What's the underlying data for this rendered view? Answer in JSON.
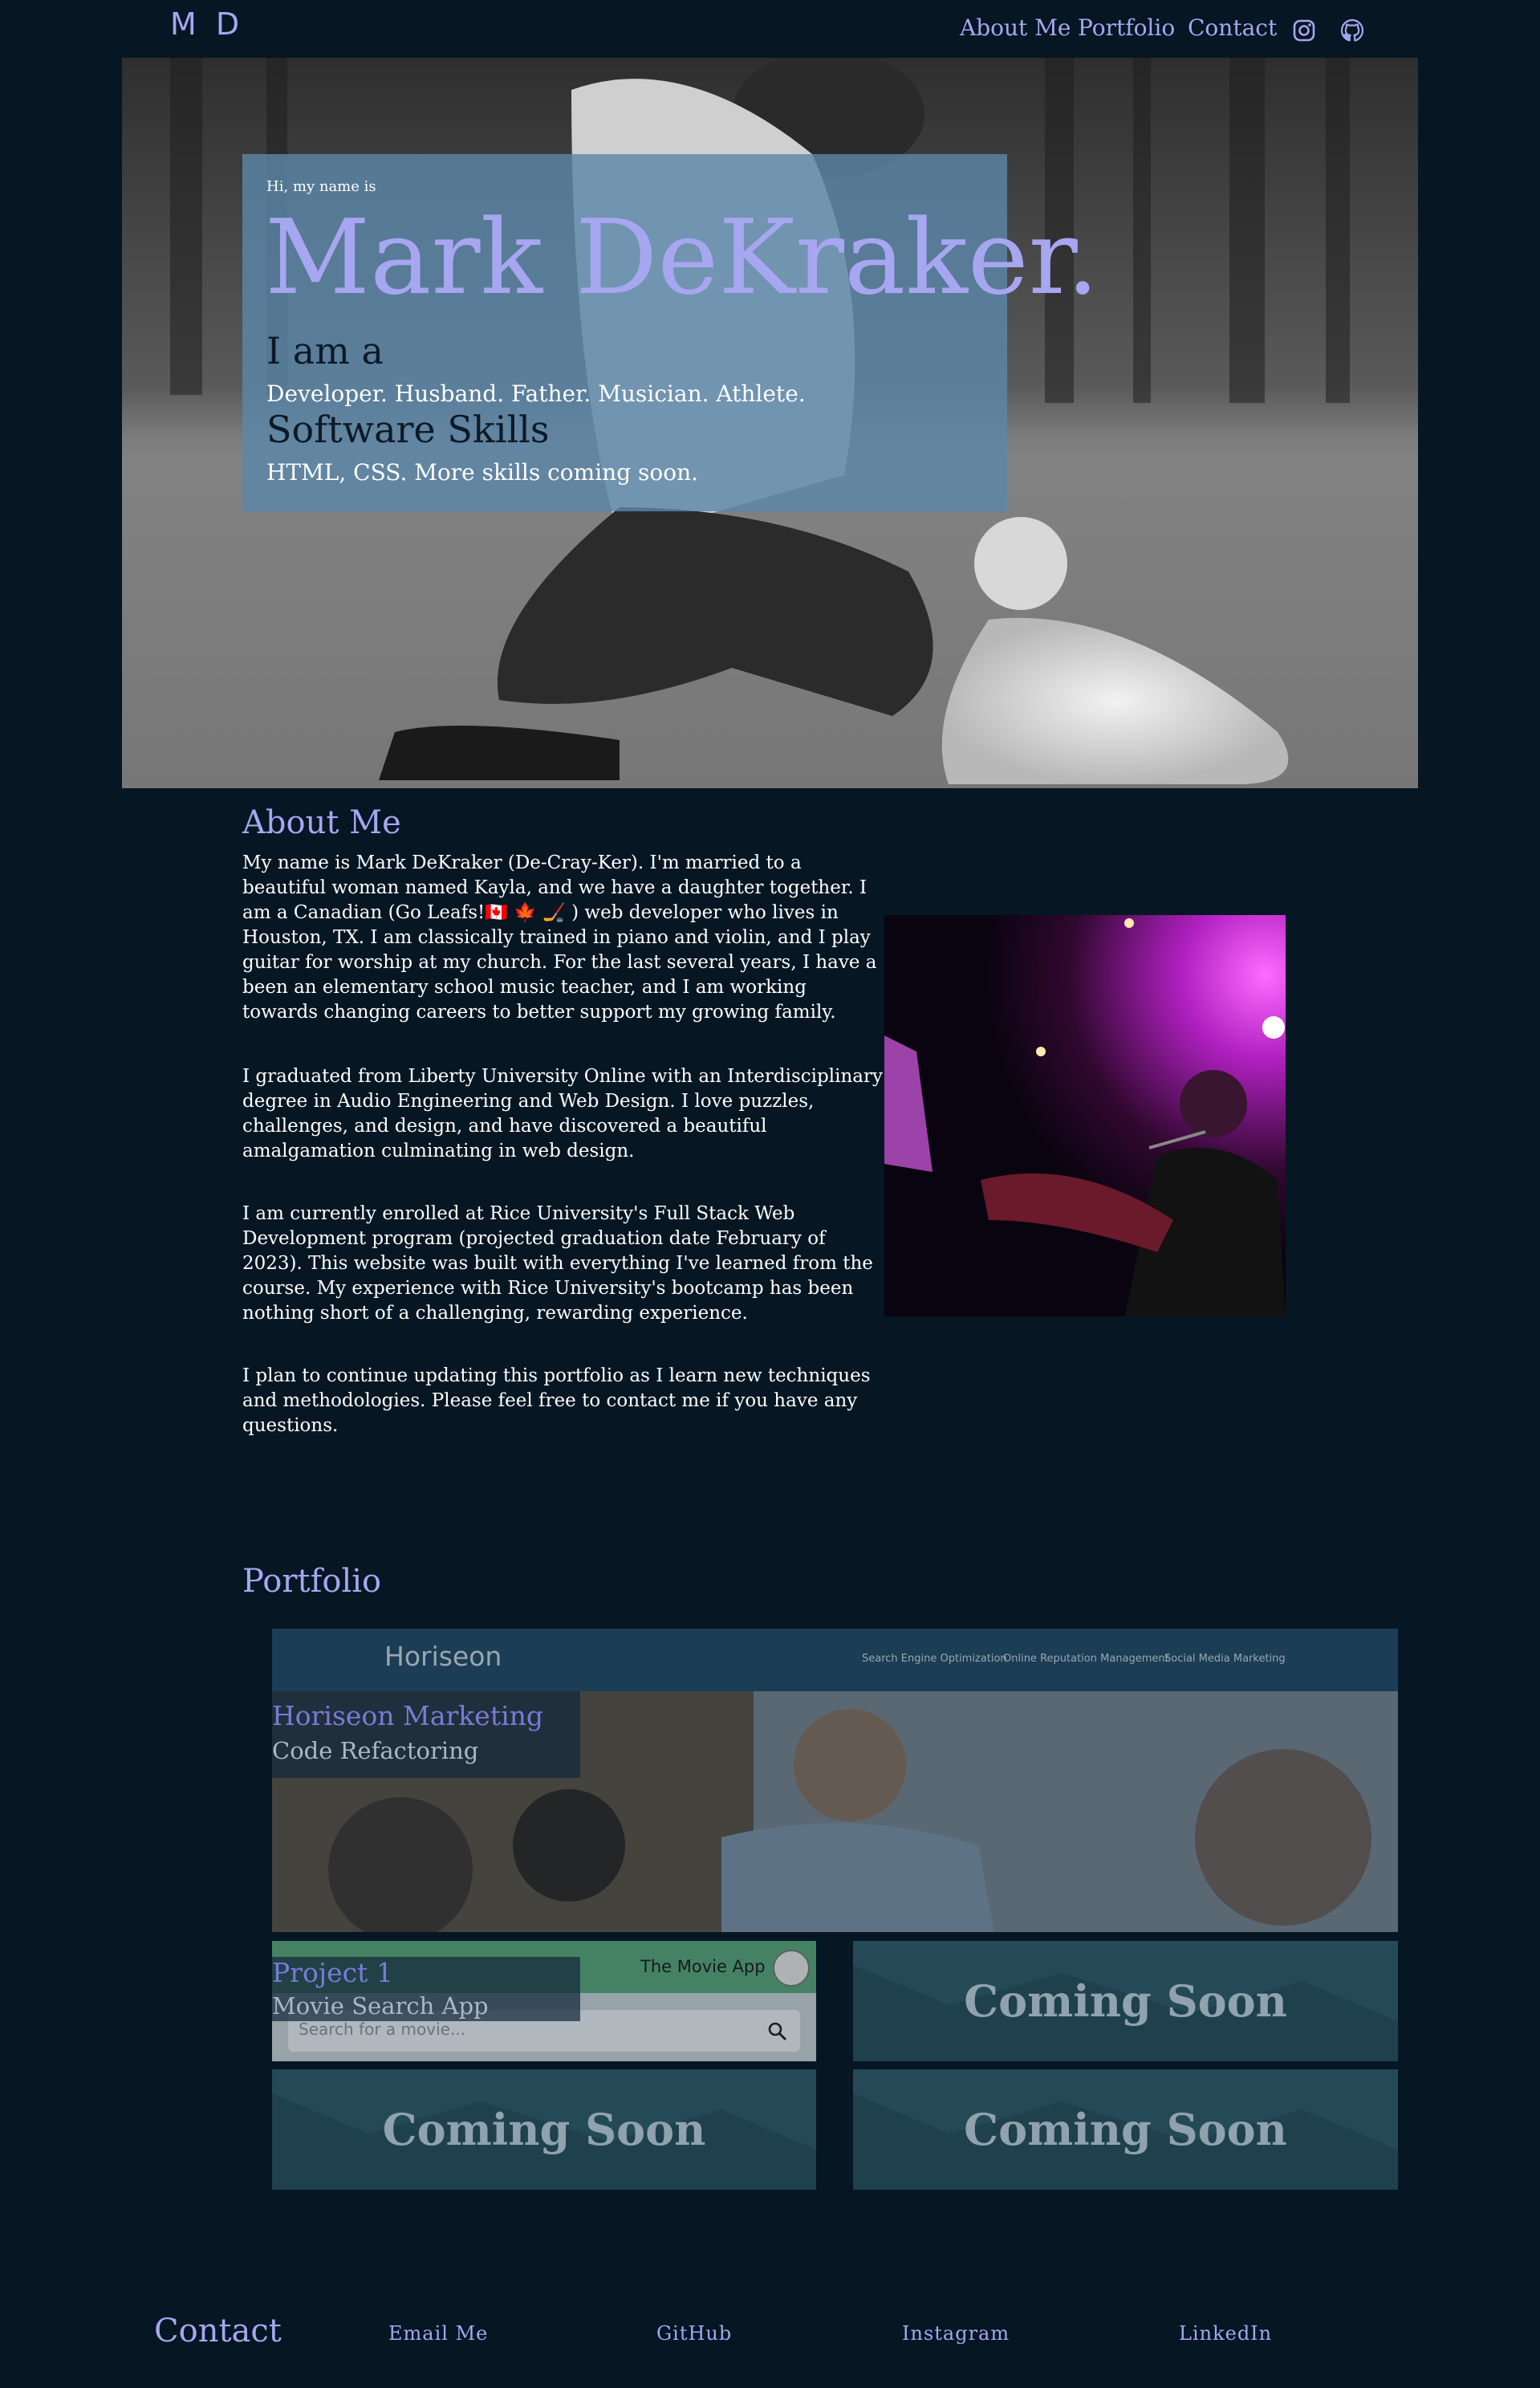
{
  "header": {
    "logo": "M D",
    "nav": [
      "About Me",
      "Portfolio",
      "Contact"
    ],
    "icons": [
      "instagram-icon",
      "github-icon"
    ]
  },
  "hero": {
    "greeting": "Hi, my name is",
    "name": "Mark DeKraker.",
    "iam_heading": "I am a",
    "iam_text": "Developer. Husband. Father. Musician. Athlete.",
    "skills_heading": "Software Skills",
    "skills_text": "HTML, CSS. More skills coming soon."
  },
  "about": {
    "title": "About Me",
    "paragraphs": [
      "My name is Mark DeKraker (De-Cray-Ker). I'm married to a beautiful woman named Kayla, and we have a daughter together. I am a Canadian (Go Leafs!🇨🇦 🍁 🏒 ) web developer who lives in Houston, TX. I am classically trained in piano and violin, and I play guitar for worship at my church. For the last several years, I have a been an elementary school music teacher, and I am working towards changing careers to better support my growing family.",
      "I graduated from Liberty University Online with an Interdisciplinary degree in Audio Engineering and Web Design. I love puzzles, challenges, and design, and have discovered a beautiful amalgamation culminating in web design.",
      "I am currently enrolled at Rice University's Full Stack Web Development program (projected graduation date February of 2023). This website was built with everything I've learned from the course. My experience with Rice University's bootcamp has been nothing short of a challenging, rewarding experience.",
      "I plan to continue updating this portfolio as I learn new techniques and methodologies. Please feel free to contact me if you have any questions."
    ]
  },
  "portfolio": {
    "title": "Portfolio",
    "featured": {
      "title": "Horiseon Marketing",
      "subtitle": "Code Refactoring",
      "screenshot_brand": "Horiseon",
      "screenshot_nav": [
        "Search Engine Optimization",
        "Online Reputation Management",
        "Social Media Marketing"
      ]
    },
    "project1": {
      "title": "Project 1",
      "subtitle": "Movie Search App",
      "screenshot_title": "The Movie App",
      "screenshot_placeholder": "Search for a movie..."
    },
    "coming_soon": [
      "Coming Soon",
      "Coming Soon",
      "Coming Soon"
    ]
  },
  "contact": {
    "title": "Contact",
    "links": [
      "Email Me",
      "GitHub",
      "Instagram",
      "LinkedIn"
    ]
  },
  "colors": {
    "background": "#061623",
    "accent": "#a7a6f0",
    "hero_card": "#5c86a8",
    "nav_bar_dark": "#1b3d55",
    "movie_header": "#5aa67a"
  }
}
